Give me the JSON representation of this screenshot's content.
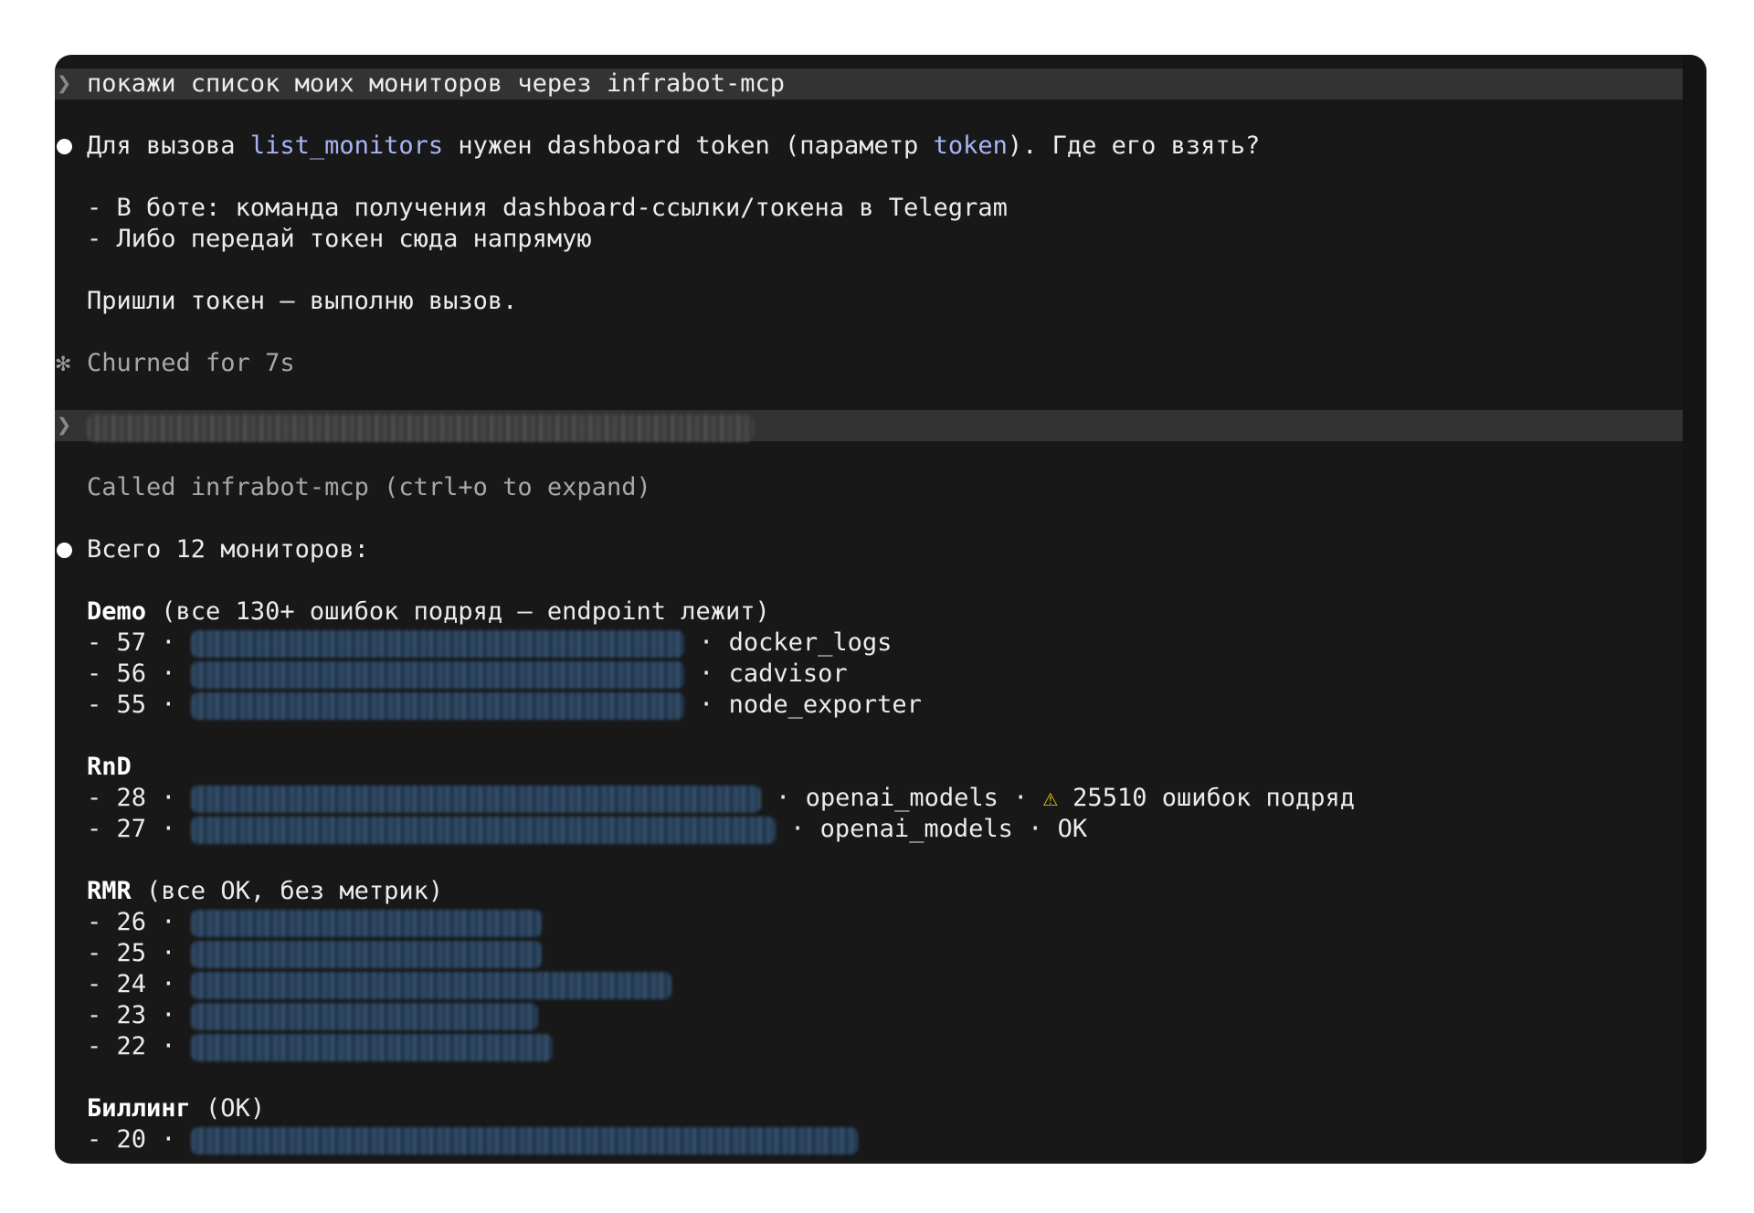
{
  "prompt1": {
    "chevron": "❯",
    "text": "покажи список моих мониторов через infrabot-mcp"
  },
  "reply1": {
    "pre": "Для вызова ",
    "code1": "list_monitors",
    "mid": " нужен dashboard token (параметр ",
    "code2": "token",
    "post": "). Где его взять?",
    "opt1": "- В боте: команда получения dashboard-ссылки/токена в Telegram",
    "opt2": "- Либо передай токен сюда напрямую",
    "ending": "Пришли токен — выполню вызов."
  },
  "churn": {
    "symbol": "✻",
    "text": "Churned for 7s"
  },
  "prompt2": {
    "chevron": "❯"
  },
  "tool_call": "Called infrabot-mcp (ctrl+o to expand)",
  "summary": "Всего 12 мониторов:",
  "groups": {
    "demo": {
      "name": "Demo",
      "note": " (все 130+ ошибок подряд — endpoint лежит)",
      "rows": [
        {
          "prefix": "- 57 · ",
          "suffix": " · docker_logs"
        },
        {
          "prefix": "- 56 · ",
          "suffix": " · cadvisor"
        },
        {
          "prefix": "- 55 · ",
          "suffix": " · node_exporter"
        }
      ]
    },
    "rnd": {
      "name": "RnD",
      "rows": [
        {
          "prefix": "- 28 · ",
          "suffix": " · openai_models · ",
          "warn": "⚠",
          "tail": " 25510 ошибок подряд"
        },
        {
          "prefix": "- 27 · ",
          "suffix": " · openai_models · OK"
        }
      ]
    },
    "rmr": {
      "name": "RMR",
      "note": " (все OK, без метрик)",
      "rows": [
        "- 26 · ",
        "- 25 · ",
        "- 24 · ",
        "- 23 · ",
        "- 22 · "
      ]
    },
    "billing": {
      "name": "Биллинг",
      "note": " (OK)",
      "rows": [
        "- 20 · "
      ]
    }
  }
}
